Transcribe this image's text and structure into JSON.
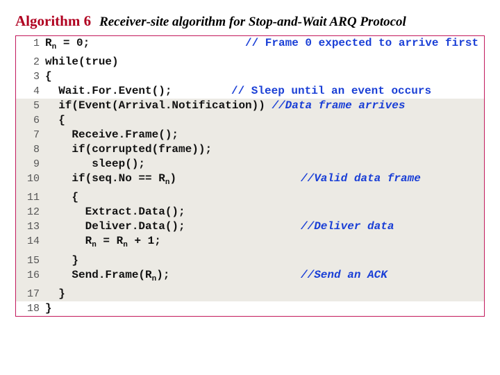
{
  "header": {
    "algo_num": "Algorithm 6",
    "title": "Receiver-site algorithm for Stop-and-Wait ARQ Protocol"
  },
  "lines": {
    "l1_num": "1",
    "l1_code_a": "R",
    "l1_code_b": "n",
    "l1_code_c": " = 0;",
    "l1_cmt": "// Frame 0 expected to arrive first",
    "l2_num": "2",
    "l2_code": "while(true)",
    "l3_num": "3",
    "l3_code": "{",
    "l4_num": "4",
    "l4_code": "  Wait.For.Event();",
    "l4_cmt": "// Sleep until an event occurs",
    "l5_num": "5",
    "l5_code": "  if(Event(Arrival.Notification)) ",
    "l5_cmt": "//Data frame arrives",
    "l6_num": "6",
    "l6_code": "  {",
    "l7_num": "7",
    "l7_code": "    Receive.Frame();",
    "l8_num": "8",
    "l8_code": "    if(corrupted(frame));",
    "l9_num": "9",
    "l9_code": "       sleep();",
    "l10_num": "10",
    "l10_code": "    if(seq.No == R",
    "l10_code_b": "n",
    "l10_code_c": ")",
    "l10_cmt": "//Valid data frame",
    "l11_num": "11",
    "l11_code": "    {",
    "l12_num": "12",
    "l12_code": "      Extract.Data();",
    "l13_num": "13",
    "l13_code": "      Deliver.Data();",
    "l13_cmt": "//Deliver data",
    "l14_num": "14",
    "l14_code_a": "      R",
    "l14_code_b": "n",
    "l14_code_c": " = R",
    "l14_code_d": "n",
    "l14_code_e": " + 1;",
    "l15_num": "15",
    "l15_code": "    }",
    "l16_num": "16",
    "l16_code": "    Send.Frame(R",
    "l16_code_b": "n",
    "l16_code_c": ");",
    "l16_cmt": "//Send an ACK",
    "l17_num": "17",
    "l17_code": "  }",
    "l18_num": "18",
    "l18_code": "}"
  }
}
